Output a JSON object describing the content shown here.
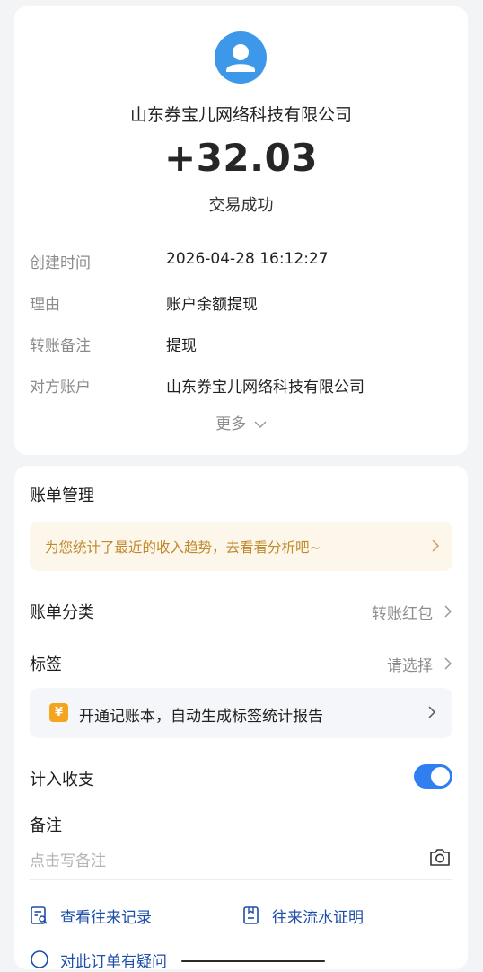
{
  "transaction": {
    "merchant": "山东券宝儿网络科技有限公司",
    "amount": "+32.03",
    "status": "交易成功",
    "details": [
      {
        "label": "创建时间",
        "value": "2026-04-28 16:12:27"
      },
      {
        "label": "理由",
        "value": "账户余额提现"
      },
      {
        "label": "转账备注",
        "value": "提现"
      },
      {
        "label": "对方账户",
        "value": "山东券宝儿网络科技有限公司"
      }
    ],
    "more_label": "更多"
  },
  "bill_management": {
    "title": "账单管理",
    "banner_text": "为您统计了最近的收入趋势，去看看分析吧~",
    "category": {
      "label": "账单分类",
      "value": "转账红包"
    },
    "tag": {
      "label": "标签",
      "value": "请选择"
    },
    "promo": {
      "icon_text": "¥",
      "text": "开通记账本，自动生成标签统计报告"
    },
    "income_expense": {
      "label": "计入收支",
      "enabled": true
    },
    "note": {
      "label": "备注",
      "placeholder": "点击写备注"
    },
    "links": [
      {
        "text": "查看往来记录"
      },
      {
        "text": "往来流水证明"
      }
    ],
    "partial_link": {
      "text": "对此订单有疑问"
    }
  },
  "colors": {
    "accent": "#2f7ff0",
    "link": "#1d4ea8",
    "banner_text": "#c08a2c",
    "avatar": "#3e98ea"
  }
}
